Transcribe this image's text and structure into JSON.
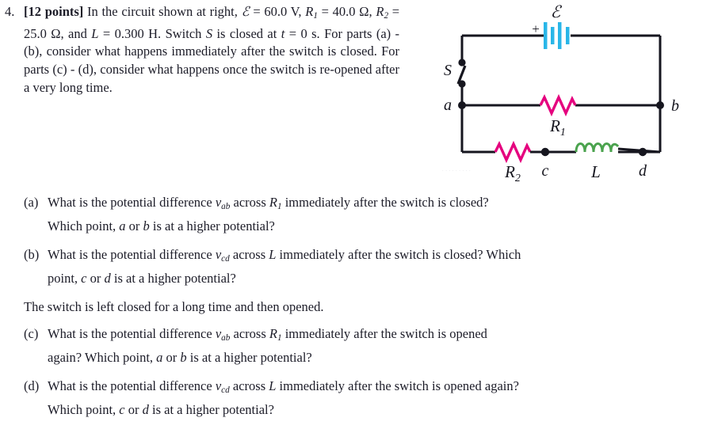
{
  "problem": {
    "number": "4.",
    "points_label": "[12 points]",
    "text_before_values": "In the circuit shown at right,",
    "emf_symbol": "ℰ",
    "emf_value": "= 60.0 V,",
    "r1_symbol": "R",
    "r1_sub": "1",
    "r1_value": "= 40.0 Ω,",
    "r2_symbol": "R",
    "r2_sub": "2",
    "r2_value": "= 25.0 Ω, and",
    "l_symbol": "L",
    "l_value": "= 0.300 H.",
    "switch_sentence_a": "Switch",
    "switch_symbol": "S",
    "switch_sentence_b": "is closed at",
    "time_symbol": "t",
    "time_value": "= 0 s.",
    "switch_sentence_c": "For parts (a) - (b), consider what happens immediately after the switch is closed. For parts (c) - (d), consider what happens once the switch is re-opened after a very long time."
  },
  "figure": {
    "name": "rl-circuit-diagram",
    "emf_label": "ℰ",
    "polarity_label": "+",
    "switch_label": "S",
    "node_a_label": "a",
    "node_b_label": "b",
    "node_c_label": "c",
    "node_d_label": "d",
    "r1_label": "R",
    "r1_sub": "1",
    "r2_label": "R",
    "r2_sub": "2",
    "inductor_label": "L",
    "watermark": "· · · · · · · · ·",
    "colors": {
      "wire": "#16161f",
      "battery": "#29b6e8",
      "resistor": "#e5007e",
      "inductor": "#4ba34e",
      "node": "#16161f",
      "label": "#16161f"
    }
  },
  "questions": [
    {
      "marker": "(a)",
      "segments": [
        {
          "type": "text",
          "value": "What is the potential difference "
        },
        {
          "type": "math",
          "value": "v",
          "sub": "ab"
        },
        {
          "type": "text",
          "value": " across "
        },
        {
          "type": "math",
          "value": "R",
          "sub": "1"
        },
        {
          "type": "text",
          "value": " immediately after the switch is closed? Which point, "
        },
        {
          "type": "math",
          "value": "a"
        },
        {
          "type": "text",
          "value": " or "
        },
        {
          "type": "math",
          "value": "b"
        },
        {
          "type": "text",
          "value": " is at a higher potential?"
        }
      ],
      "line1": "What is the potential difference vₐᵇ across R₁ immediately after the switch is closed?",
      "line2": "Which point, a or b is at a higher potential?"
    },
    {
      "marker": "(b)",
      "line1": "What is the potential difference vᶜᵈ across L immediately after the switch is closed? Which",
      "line2": "point, c or d is at a higher potential?"
    },
    {
      "marker": "(c)",
      "line1": "What is the potential difference vₐᵇ across R₁ immediately after the switch is opened",
      "line2": "again? Which point, a or b is at a higher potential?"
    },
    {
      "marker": "(d)",
      "line1": "What is the potential difference vᶜᵈ across L immediately after the switch is opened again?",
      "line2": "Which point, c or d is at a higher potential?"
    }
  ],
  "interlude": {
    "text": "The switch is left closed for a long time and then opened."
  }
}
